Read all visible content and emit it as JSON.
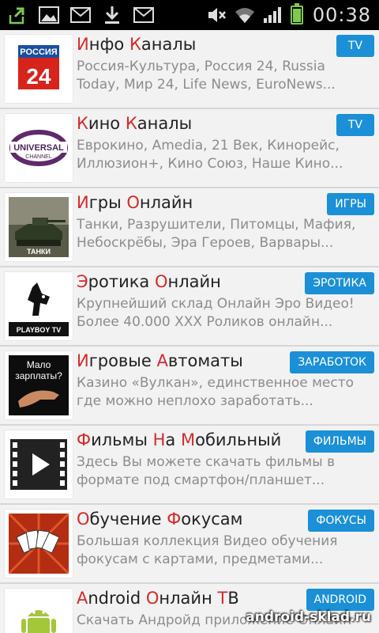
{
  "status_bar": {
    "time": "00:38",
    "left_icons": [
      "upload-icon",
      "image-icon",
      "mail-icon",
      "download-icon",
      "mail-icon"
    ],
    "right_icons": [
      "mute-icon",
      "wifi-icon",
      "signal-icon",
      "battery-icon"
    ]
  },
  "items": [
    {
      "title_parts": [
        [
          "И",
          "nfo"
        ],
        [
          "К",
          "аналы"
        ]
      ],
      "title": "Инфо Каналы",
      "desc1": "Россия-Культура, Россия 24, Russia",
      "desc2": "Today, Мир 24, Life News, EuroNews...",
      "badge": "TV",
      "thumb": "rossiya24-logo",
      "thumb_text1": "РОССИЯ",
      "thumb_text2": "24"
    },
    {
      "title": "Кино Каналы",
      "desc1": "Еврокино, Amedia, 21 Век, Кинорейс,",
      "desc2": "Иллюзион+, Кино Союз, Наше Кино...",
      "badge": "TV",
      "thumb": "universal-channel-logo",
      "thumb_text1": "UNIVERSAL",
      "thumb_text2": "CHANNEL"
    },
    {
      "title": "Игры Онлайн",
      "desc1": "Танки, Разрушители, Питомцы, Мафия,",
      "desc2": "Небоскрёбы, Эра Героев, Варвары...",
      "badge": "ИГРЫ",
      "thumb": "tanks-game-image",
      "thumb_text1": "ТАНКИ"
    },
    {
      "title": "Эротика Онлайн",
      "desc1": "Крупнейший склад Онлайн Эро Видео!",
      "desc2": "Более 40.000 XXX Роликов онлайн...",
      "badge": "ЭРОТИКА",
      "thumb": "playboy-tv-logo",
      "thumb_text1": "PLAYBOY TV"
    },
    {
      "title": "Игровые Автоматы",
      "desc1": "Казино «Вулкан», единственное место",
      "desc2": "где можно неплохо заработать...",
      "badge": "ЗАРАБОТОК",
      "thumb": "low-salary-image",
      "thumb_text1": "Мало",
      "thumb_text2": "зарплаты?"
    },
    {
      "title": "Фильмы На Мобильный",
      "desc1": "Здесь Вы можете скачать фильмы в",
      "desc2": "формате под смартфон/планшет...",
      "badge": "ФИЛЬМЫ",
      "thumb": "film-play-icon"
    },
    {
      "title": "Обучение Фокусам",
      "desc1": "Большая коллекция Видео обучения",
      "desc2": "фокусам с картами, предметами...",
      "badge": "ФОКУСЫ",
      "thumb": "playing-cards-image"
    },
    {
      "title": "Android Онлайн ТВ",
      "desc1": "Скачать Андройд приложение Онлайн",
      "desc2": "",
      "badge": "ANDROID",
      "thumb": "android-robot-icon"
    }
  ],
  "title_caps": [
    [
      "И",
      "нфо ",
      "К",
      "аналы"
    ],
    [
      "К",
      "ино ",
      "К",
      "аналы"
    ],
    [
      "И",
      "гры ",
      "О",
      "нлайн"
    ],
    [
      "Э",
      "ротика ",
      "О",
      "нлайн"
    ],
    [
      "И",
      "гровые ",
      "А",
      "втоматы"
    ],
    [
      "Ф",
      "ильмы ",
      "Н",
      "а ",
      "М",
      "обильный"
    ],
    [
      "О",
      "бучение ",
      "Ф",
      "окусам"
    ],
    [
      "A",
      "ndroid ",
      "О",
      "нлайн ",
      "Т",
      "В"
    ]
  ],
  "watermark": "android-sklad.ru",
  "colors": {
    "accent": "#d42a2a",
    "badge": "#1b90d6",
    "status_bar": "#000000"
  }
}
